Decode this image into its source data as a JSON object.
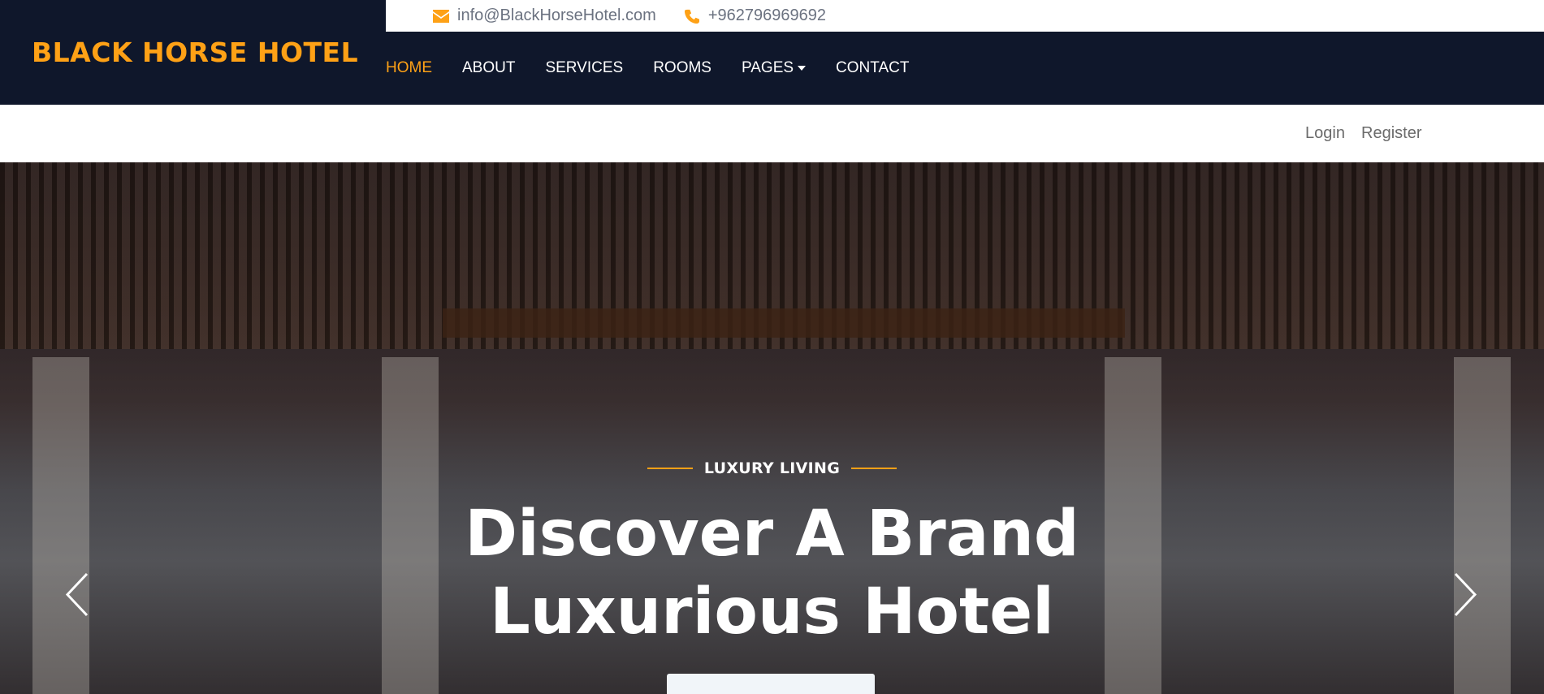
{
  "brand": {
    "name": "BLACK HORSE HOTEL"
  },
  "topbar": {
    "email": "info@BlackHorseHotel.com",
    "phone": "+962796969692",
    "email_icon": "envelope-icon",
    "phone_icon": "phone-icon"
  },
  "nav": {
    "items": [
      {
        "label": "HOME",
        "active": true
      },
      {
        "label": "ABOUT"
      },
      {
        "label": "SERVICES"
      },
      {
        "label": "ROOMS"
      },
      {
        "label": "PAGES",
        "dropdown": true
      },
      {
        "label": "CONTACT"
      }
    ]
  },
  "auth": {
    "login": "Login",
    "register": "Register"
  },
  "hero": {
    "tagline": "LUXURY LIVING",
    "headline_line1": "Discover A Brand",
    "headline_line2": "Luxurious Hotel",
    "prev_icon": "chevron-left-icon",
    "next_icon": "chevron-right-icon"
  },
  "colors": {
    "accent": "#fea116",
    "header_bg": "#0f172b",
    "text_muted": "#6b7280"
  }
}
